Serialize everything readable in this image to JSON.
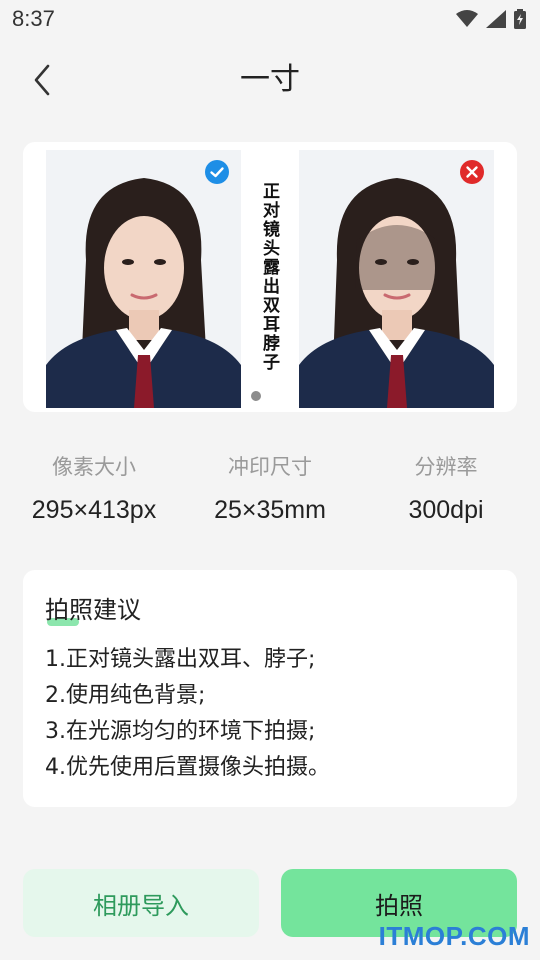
{
  "status_bar": {
    "time": "8:37",
    "icons": [
      "wifi-icon",
      "signal-icon",
      "battery-charging-icon"
    ]
  },
  "header": {
    "title": "一寸",
    "back_icon": "chevron-left-icon"
  },
  "sample": {
    "good_badge_icon": "check-circle-icon",
    "bad_badge_icon": "x-circle-icon",
    "caption": "正对镜头露出双耳脖子",
    "colors": {
      "good": "#1e8ee6",
      "bad": "#e02a2a"
    }
  },
  "specs": [
    {
      "label": "像素大小",
      "value": "295×413px"
    },
    {
      "label": "冲印尺寸",
      "value": "25×35mm"
    },
    {
      "label": "分辨率",
      "value": "300dpi"
    }
  ],
  "tips": {
    "title": "拍照建议",
    "items": [
      "1.正对镜头露出双耳、脖子;",
      "2.使用纯色背景;",
      "3.在光源均匀的环境下拍摄;",
      "4.优先使用后置摄像头拍摄。"
    ]
  },
  "buttons": {
    "import_label": "相册导入",
    "photo_label": "拍照"
  },
  "colors": {
    "accent": "#74e49c",
    "accent_light": "#e5f7ec",
    "accent_text": "#2e9a5c"
  },
  "watermark": "ITMOP.COM"
}
